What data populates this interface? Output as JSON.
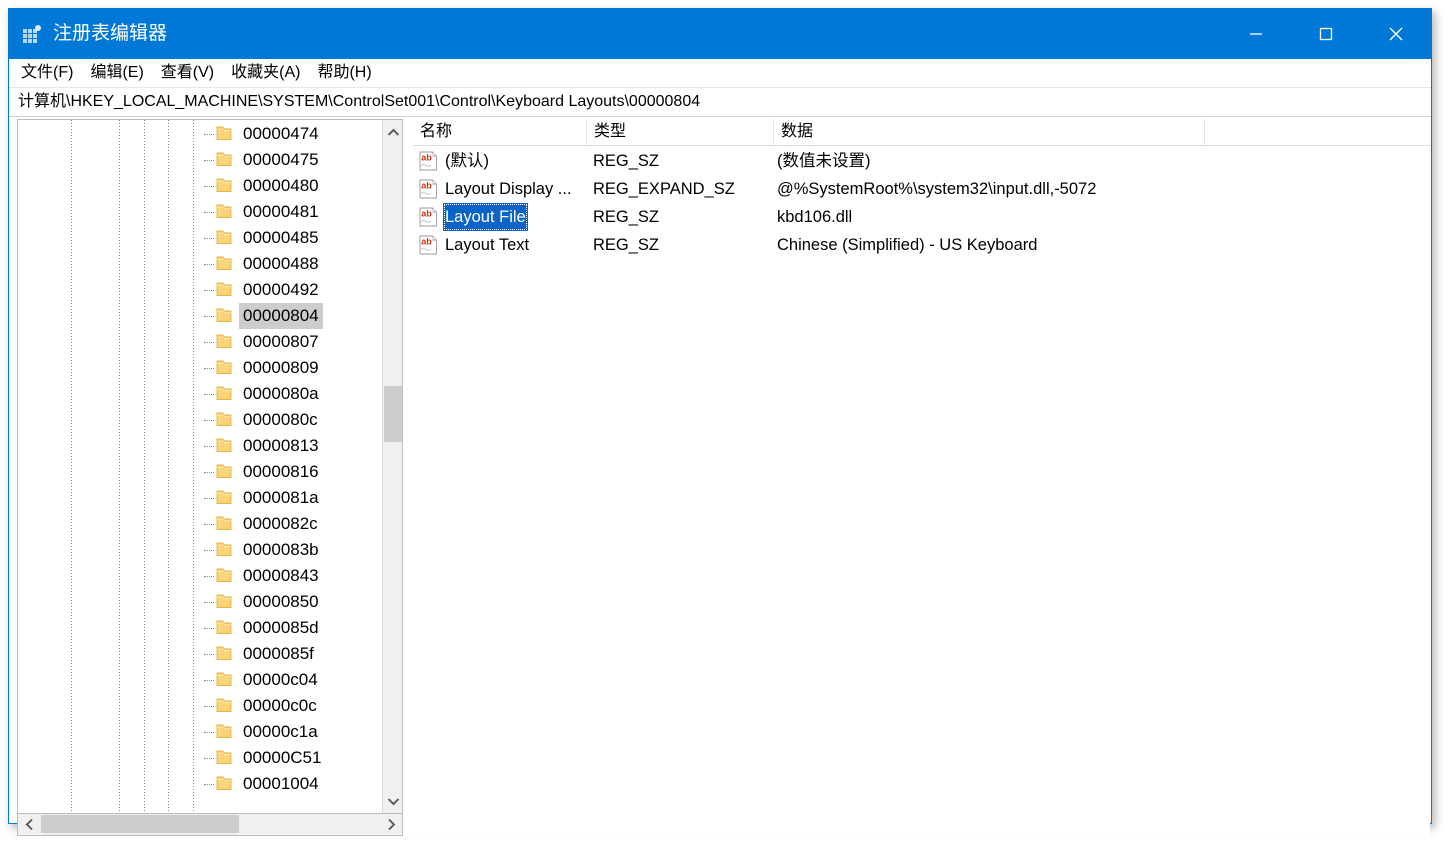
{
  "window": {
    "title": "注册表编辑器",
    "icon": "registry-icon",
    "accent_color": "#0078d7",
    "controls": {
      "minimize": "minimize-icon",
      "maximize": "maximize-icon",
      "close": "close-icon"
    }
  },
  "menubar": {
    "items": [
      {
        "label": "文件(F)"
      },
      {
        "label": "编辑(E)"
      },
      {
        "label": "查看(V)"
      },
      {
        "label": "收藏夹(A)"
      },
      {
        "label": "帮助(H)"
      }
    ]
  },
  "address": {
    "path": "计算机\\HKEY_LOCAL_MACHINE\\SYSTEM\\ControlSet001\\Control\\Keyboard Layouts\\00000804"
  },
  "tree": {
    "selected_key": "00000804",
    "items": [
      {
        "label": "00000474",
        "selected": false
      },
      {
        "label": "00000475",
        "selected": false
      },
      {
        "label": "00000480",
        "selected": false
      },
      {
        "label": "00000481",
        "selected": false
      },
      {
        "label": "00000485",
        "selected": false
      },
      {
        "label": "00000488",
        "selected": false
      },
      {
        "label": "00000492",
        "selected": false
      },
      {
        "label": "00000804",
        "selected": true
      },
      {
        "label": "00000807",
        "selected": false
      },
      {
        "label": "00000809",
        "selected": false
      },
      {
        "label": "0000080a",
        "selected": false
      },
      {
        "label": "0000080c",
        "selected": false
      },
      {
        "label": "00000813",
        "selected": false
      },
      {
        "label": "00000816",
        "selected": false
      },
      {
        "label": "0000081a",
        "selected": false
      },
      {
        "label": "0000082c",
        "selected": false
      },
      {
        "label": "0000083b",
        "selected": false
      },
      {
        "label": "00000843",
        "selected": false
      },
      {
        "label": "00000850",
        "selected": false
      },
      {
        "label": "0000085d",
        "selected": false
      },
      {
        "label": "0000085f",
        "selected": false
      },
      {
        "label": "00000c04",
        "selected": false
      },
      {
        "label": "00000c0c",
        "selected": false
      },
      {
        "label": "00000c1a",
        "selected": false
      },
      {
        "label": "00000C51",
        "selected": false
      },
      {
        "label": "00001004",
        "selected": false
      }
    ],
    "scroll": {
      "up_arrow": "chevron-up-icon",
      "down_arrow": "chevron-down-icon",
      "left_arrow": "chevron-left-icon",
      "right_arrow": "chevron-right-icon"
    }
  },
  "list": {
    "columns": [
      {
        "label": "名称"
      },
      {
        "label": "类型"
      },
      {
        "label": "数据"
      }
    ],
    "rows": [
      {
        "name": "(默认)",
        "type": "REG_SZ",
        "data": "(数值未设置)",
        "icon": "string-value-icon",
        "selected": false
      },
      {
        "name": "Layout Display ...",
        "type": "REG_EXPAND_SZ",
        "data": "@%SystemRoot%\\system32\\input.dll,-5072",
        "icon": "string-value-icon",
        "selected": false
      },
      {
        "name": "Layout File",
        "type": "REG_SZ",
        "data": "kbd106.dll",
        "icon": "string-value-icon",
        "selected": true
      },
      {
        "name": "Layout Text",
        "type": "REG_SZ",
        "data": "Chinese (Simplified) - US Keyboard",
        "icon": "string-value-icon",
        "selected": false
      }
    ]
  }
}
